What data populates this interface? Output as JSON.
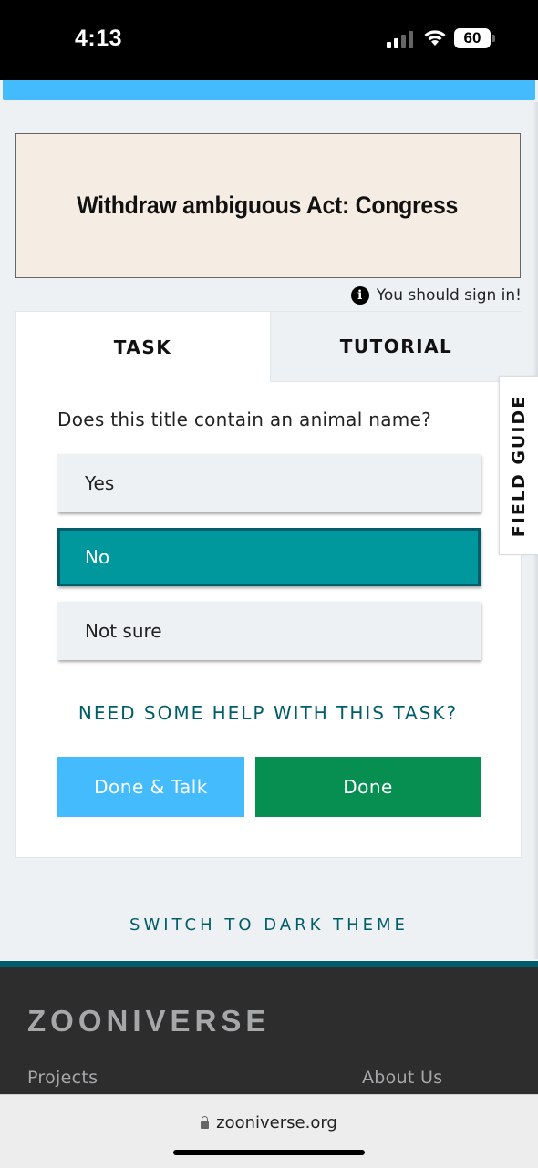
{
  "status_bar": {
    "time": "4:13",
    "battery": "60"
  },
  "subject": {
    "text": "Withdraw ambiguous Act: Congress"
  },
  "sign_in_notice": "You should sign in!",
  "tabs": [
    {
      "label": "TASK",
      "active": true
    },
    {
      "label": "TUTORIAL",
      "active": false
    }
  ],
  "task": {
    "question": "Does this title contain an animal name?",
    "answers": [
      {
        "label": "Yes",
        "selected": false
      },
      {
        "label": "No",
        "selected": true
      },
      {
        "label": "Not sure",
        "selected": false
      }
    ],
    "help_link": "NEED SOME HELP WITH THIS TASK?",
    "done_talk_label": "Done & Talk",
    "done_label": "Done"
  },
  "field_guide_label": "FIELD GUIDE",
  "theme_toggle": "SWITCH TO DARK THEME",
  "footer": {
    "logo": "ZOONIVERSE",
    "links": [
      "Projects",
      "About Us"
    ]
  },
  "browser": {
    "url": "zooniverse.org"
  },
  "colors": {
    "accent_blue": "#43bbfd",
    "teal_selected": "#00979d",
    "done_green": "#078f52",
    "link_teal": "#005d69"
  }
}
